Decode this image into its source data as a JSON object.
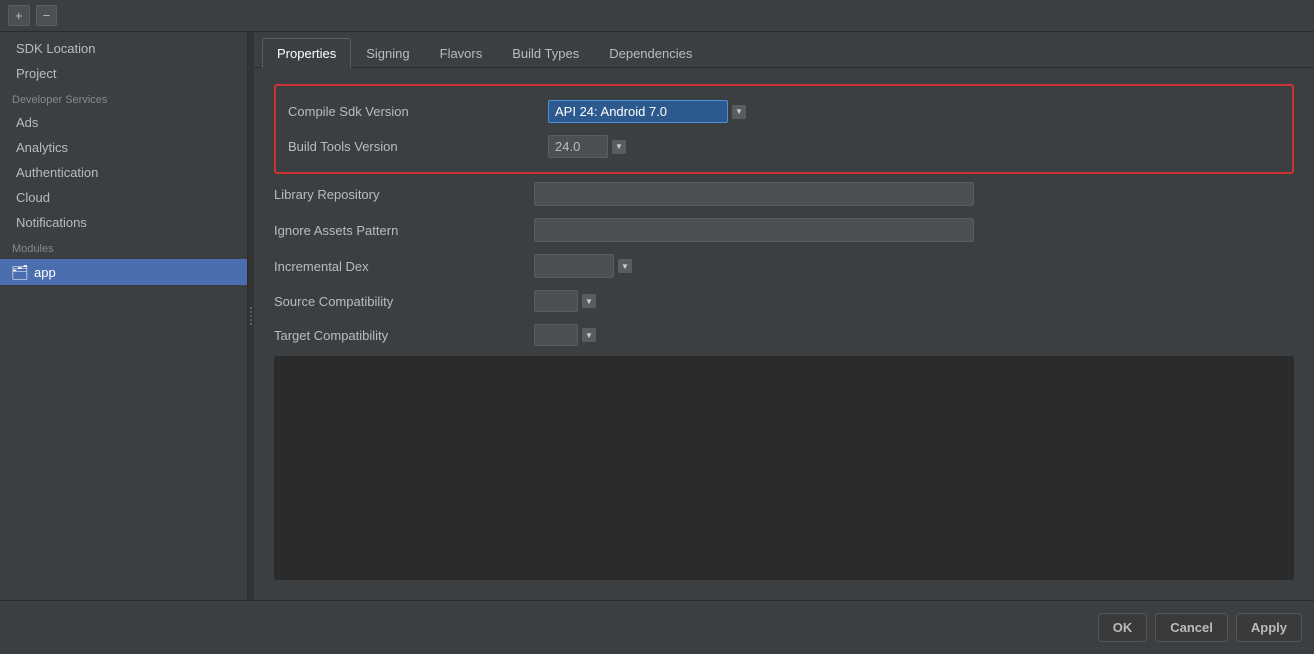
{
  "toolbar": {
    "add_label": "+",
    "remove_label": "−"
  },
  "sidebar": {
    "items": [
      {
        "id": "sdk-location",
        "label": "SDK Location"
      },
      {
        "id": "project",
        "label": "Project"
      },
      {
        "id": "developer-services",
        "label": "Developer Services",
        "type": "section-header"
      },
      {
        "id": "ads",
        "label": "Ads"
      },
      {
        "id": "analytics",
        "label": "Analytics"
      },
      {
        "id": "authentication",
        "label": "Authentication"
      },
      {
        "id": "cloud",
        "label": "Cloud"
      },
      {
        "id": "notifications",
        "label": "Notifications"
      },
      {
        "id": "modules",
        "label": "Modules",
        "type": "section-header"
      }
    ],
    "module_item": {
      "label": "app",
      "icon": "📁"
    }
  },
  "tabs": [
    {
      "id": "properties",
      "label": "Properties",
      "active": true
    },
    {
      "id": "signing",
      "label": "Signing"
    },
    {
      "id": "flavors",
      "label": "Flavors"
    },
    {
      "id": "build-types",
      "label": "Build Types"
    },
    {
      "id": "dependencies",
      "label": "Dependencies"
    }
  ],
  "properties": {
    "compile_sdk_version": {
      "label": "Compile Sdk Version",
      "value": "API 24: Android 7.0"
    },
    "build_tools_version": {
      "label": "Build Tools Version",
      "value": "24.0"
    },
    "library_repository": {
      "label": "Library Repository",
      "value": ""
    },
    "ignore_assets_pattern": {
      "label": "Ignore Assets Pattern",
      "value": ""
    },
    "incremental_dex": {
      "label": "Incremental Dex",
      "value": ""
    },
    "source_compatibility": {
      "label": "Source Compatibility",
      "value": ""
    },
    "target_compatibility": {
      "label": "Target Compatibility",
      "value": ""
    }
  },
  "bottom_buttons": [
    {
      "id": "ok",
      "label": "OK"
    },
    {
      "id": "cancel",
      "label": "Cancel"
    },
    {
      "id": "apply",
      "label": "Apply"
    }
  ],
  "icons": {
    "dropdown_arrow": "▼",
    "folder": "🗂",
    "grip": "⋮"
  }
}
